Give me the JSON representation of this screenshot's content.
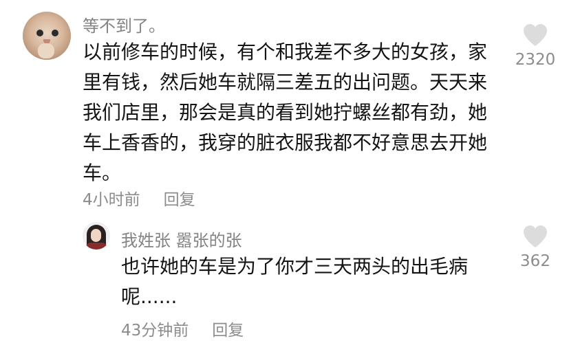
{
  "comments": [
    {
      "username": "等不到了。",
      "text": "以前修车的时候，有个和我差不多大的女孩，家里有钱，然后她车就隔三差五的出问题。天天来我们店里，那会是真的看到她拧螺丝都有劲，她车上香香的，我穿的脏衣服我都不好意思去开她车。",
      "time": "4小时前",
      "reply_label": "回复",
      "likes": "2320"
    },
    {
      "username": "我姓张 嚣张的张",
      "text": "也许她的车是为了你才三天两头的出毛病呢......",
      "time": "43分钟前",
      "reply_label": "回复",
      "likes": "362"
    }
  ],
  "colors": {
    "username": "#838383",
    "text": "#141414",
    "meta": "#8c8c8c",
    "heart": "#dcdcdc"
  }
}
